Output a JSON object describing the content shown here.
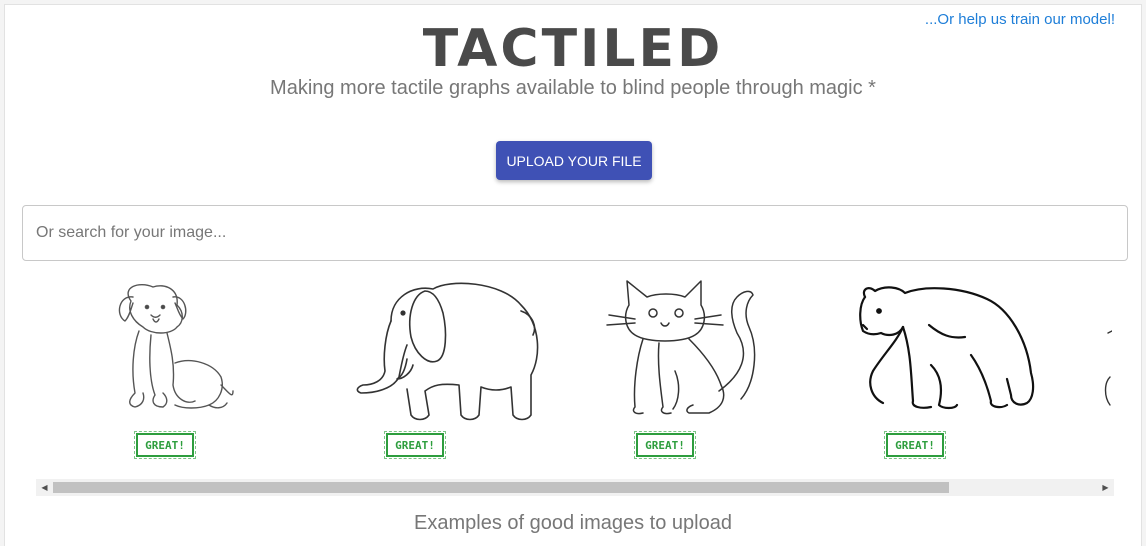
{
  "header": {
    "train_link": "...Or help us train our model!",
    "logo_text": "TACTILED",
    "tagline": "Making more tactile graphs available to blind people through magic *"
  },
  "upload": {
    "label": "UPLOAD YOUR FILE"
  },
  "search": {
    "placeholder": "Or search for your image...",
    "value": ""
  },
  "examples": {
    "items": [
      {
        "icon": "dog-drawing",
        "stamp": "GREAT!"
      },
      {
        "icon": "elephant-drawing",
        "stamp": "GREAT!"
      },
      {
        "icon": "cat-drawing",
        "stamp": "GREAT!"
      },
      {
        "icon": "bear-drawing",
        "stamp": "GREAT!"
      }
    ],
    "caption": "Examples of good images to upload"
  },
  "colors": {
    "accent": "#3f51b5",
    "link": "#1e7ed8",
    "stamp_green": "#2e9e3e",
    "text_gray": "#777777",
    "logo_gray": "#4a4a4a"
  }
}
